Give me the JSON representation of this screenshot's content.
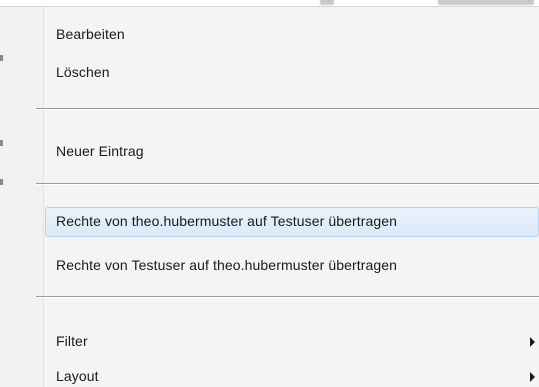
{
  "context_menu": {
    "items": [
      {
        "label": "Bearbeiten"
      },
      {
        "label": "Löschen"
      },
      {
        "label": "Neuer Eintrag"
      },
      {
        "label": "Rechte von theo.hubermuster auf Testuser übertragen",
        "highlighted": true
      },
      {
        "label": "Rechte von Testuser auf theo.hubermuster übertragen"
      },
      {
        "label": "Filter",
        "has_submenu": true
      },
      {
        "label": "Layout",
        "has_submenu": true
      }
    ]
  },
  "colors": {
    "menu_background": "#f4f4f4",
    "highlight_background": "#dce9f8",
    "highlight_border": "#b8d2ef",
    "separator": "#9a9a9a",
    "text": "#1a1a1a"
  },
  "icons": {
    "submenu_arrow": "chevron-right-icon"
  }
}
